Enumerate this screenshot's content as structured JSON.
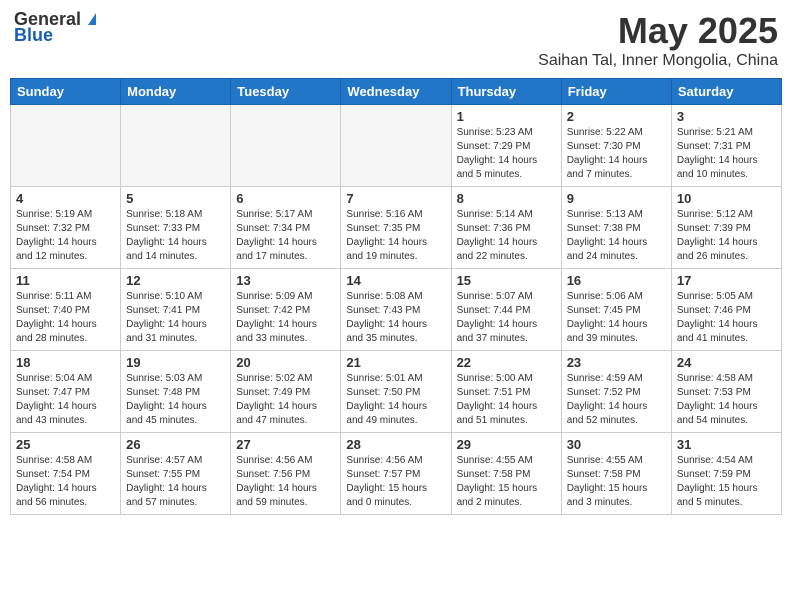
{
  "header": {
    "logo_general": "General",
    "logo_blue": "Blue",
    "month_title": "May 2025",
    "location": "Saihan Tal, Inner Mongolia, China"
  },
  "weekdays": [
    "Sunday",
    "Monday",
    "Tuesday",
    "Wednesday",
    "Thursday",
    "Friday",
    "Saturday"
  ],
  "weeks": [
    [
      {
        "day": "",
        "info": ""
      },
      {
        "day": "",
        "info": ""
      },
      {
        "day": "",
        "info": ""
      },
      {
        "day": "",
        "info": ""
      },
      {
        "day": "1",
        "info": "Sunrise: 5:23 AM\nSunset: 7:29 PM\nDaylight: 14 hours\nand 5 minutes."
      },
      {
        "day": "2",
        "info": "Sunrise: 5:22 AM\nSunset: 7:30 PM\nDaylight: 14 hours\nand 7 minutes."
      },
      {
        "day": "3",
        "info": "Sunrise: 5:21 AM\nSunset: 7:31 PM\nDaylight: 14 hours\nand 10 minutes."
      }
    ],
    [
      {
        "day": "4",
        "info": "Sunrise: 5:19 AM\nSunset: 7:32 PM\nDaylight: 14 hours\nand 12 minutes."
      },
      {
        "day": "5",
        "info": "Sunrise: 5:18 AM\nSunset: 7:33 PM\nDaylight: 14 hours\nand 14 minutes."
      },
      {
        "day": "6",
        "info": "Sunrise: 5:17 AM\nSunset: 7:34 PM\nDaylight: 14 hours\nand 17 minutes."
      },
      {
        "day": "7",
        "info": "Sunrise: 5:16 AM\nSunset: 7:35 PM\nDaylight: 14 hours\nand 19 minutes."
      },
      {
        "day": "8",
        "info": "Sunrise: 5:14 AM\nSunset: 7:36 PM\nDaylight: 14 hours\nand 22 minutes."
      },
      {
        "day": "9",
        "info": "Sunrise: 5:13 AM\nSunset: 7:38 PM\nDaylight: 14 hours\nand 24 minutes."
      },
      {
        "day": "10",
        "info": "Sunrise: 5:12 AM\nSunset: 7:39 PM\nDaylight: 14 hours\nand 26 minutes."
      }
    ],
    [
      {
        "day": "11",
        "info": "Sunrise: 5:11 AM\nSunset: 7:40 PM\nDaylight: 14 hours\nand 28 minutes."
      },
      {
        "day": "12",
        "info": "Sunrise: 5:10 AM\nSunset: 7:41 PM\nDaylight: 14 hours\nand 31 minutes."
      },
      {
        "day": "13",
        "info": "Sunrise: 5:09 AM\nSunset: 7:42 PM\nDaylight: 14 hours\nand 33 minutes."
      },
      {
        "day": "14",
        "info": "Sunrise: 5:08 AM\nSunset: 7:43 PM\nDaylight: 14 hours\nand 35 minutes."
      },
      {
        "day": "15",
        "info": "Sunrise: 5:07 AM\nSunset: 7:44 PM\nDaylight: 14 hours\nand 37 minutes."
      },
      {
        "day": "16",
        "info": "Sunrise: 5:06 AM\nSunset: 7:45 PM\nDaylight: 14 hours\nand 39 minutes."
      },
      {
        "day": "17",
        "info": "Sunrise: 5:05 AM\nSunset: 7:46 PM\nDaylight: 14 hours\nand 41 minutes."
      }
    ],
    [
      {
        "day": "18",
        "info": "Sunrise: 5:04 AM\nSunset: 7:47 PM\nDaylight: 14 hours\nand 43 minutes."
      },
      {
        "day": "19",
        "info": "Sunrise: 5:03 AM\nSunset: 7:48 PM\nDaylight: 14 hours\nand 45 minutes."
      },
      {
        "day": "20",
        "info": "Sunrise: 5:02 AM\nSunset: 7:49 PM\nDaylight: 14 hours\nand 47 minutes."
      },
      {
        "day": "21",
        "info": "Sunrise: 5:01 AM\nSunset: 7:50 PM\nDaylight: 14 hours\nand 49 minutes."
      },
      {
        "day": "22",
        "info": "Sunrise: 5:00 AM\nSunset: 7:51 PM\nDaylight: 14 hours\nand 51 minutes."
      },
      {
        "day": "23",
        "info": "Sunrise: 4:59 AM\nSunset: 7:52 PM\nDaylight: 14 hours\nand 52 minutes."
      },
      {
        "day": "24",
        "info": "Sunrise: 4:58 AM\nSunset: 7:53 PM\nDaylight: 14 hours\nand 54 minutes."
      }
    ],
    [
      {
        "day": "25",
        "info": "Sunrise: 4:58 AM\nSunset: 7:54 PM\nDaylight: 14 hours\nand 56 minutes."
      },
      {
        "day": "26",
        "info": "Sunrise: 4:57 AM\nSunset: 7:55 PM\nDaylight: 14 hours\nand 57 minutes."
      },
      {
        "day": "27",
        "info": "Sunrise: 4:56 AM\nSunset: 7:56 PM\nDaylight: 14 hours\nand 59 minutes."
      },
      {
        "day": "28",
        "info": "Sunrise: 4:56 AM\nSunset: 7:57 PM\nDaylight: 15 hours\nand 0 minutes."
      },
      {
        "day": "29",
        "info": "Sunrise: 4:55 AM\nSunset: 7:58 PM\nDaylight: 15 hours\nand 2 minutes."
      },
      {
        "day": "30",
        "info": "Sunrise: 4:55 AM\nSunset: 7:58 PM\nDaylight: 15 hours\nand 3 minutes."
      },
      {
        "day": "31",
        "info": "Sunrise: 4:54 AM\nSunset: 7:59 PM\nDaylight: 15 hours\nand 5 minutes."
      }
    ]
  ]
}
